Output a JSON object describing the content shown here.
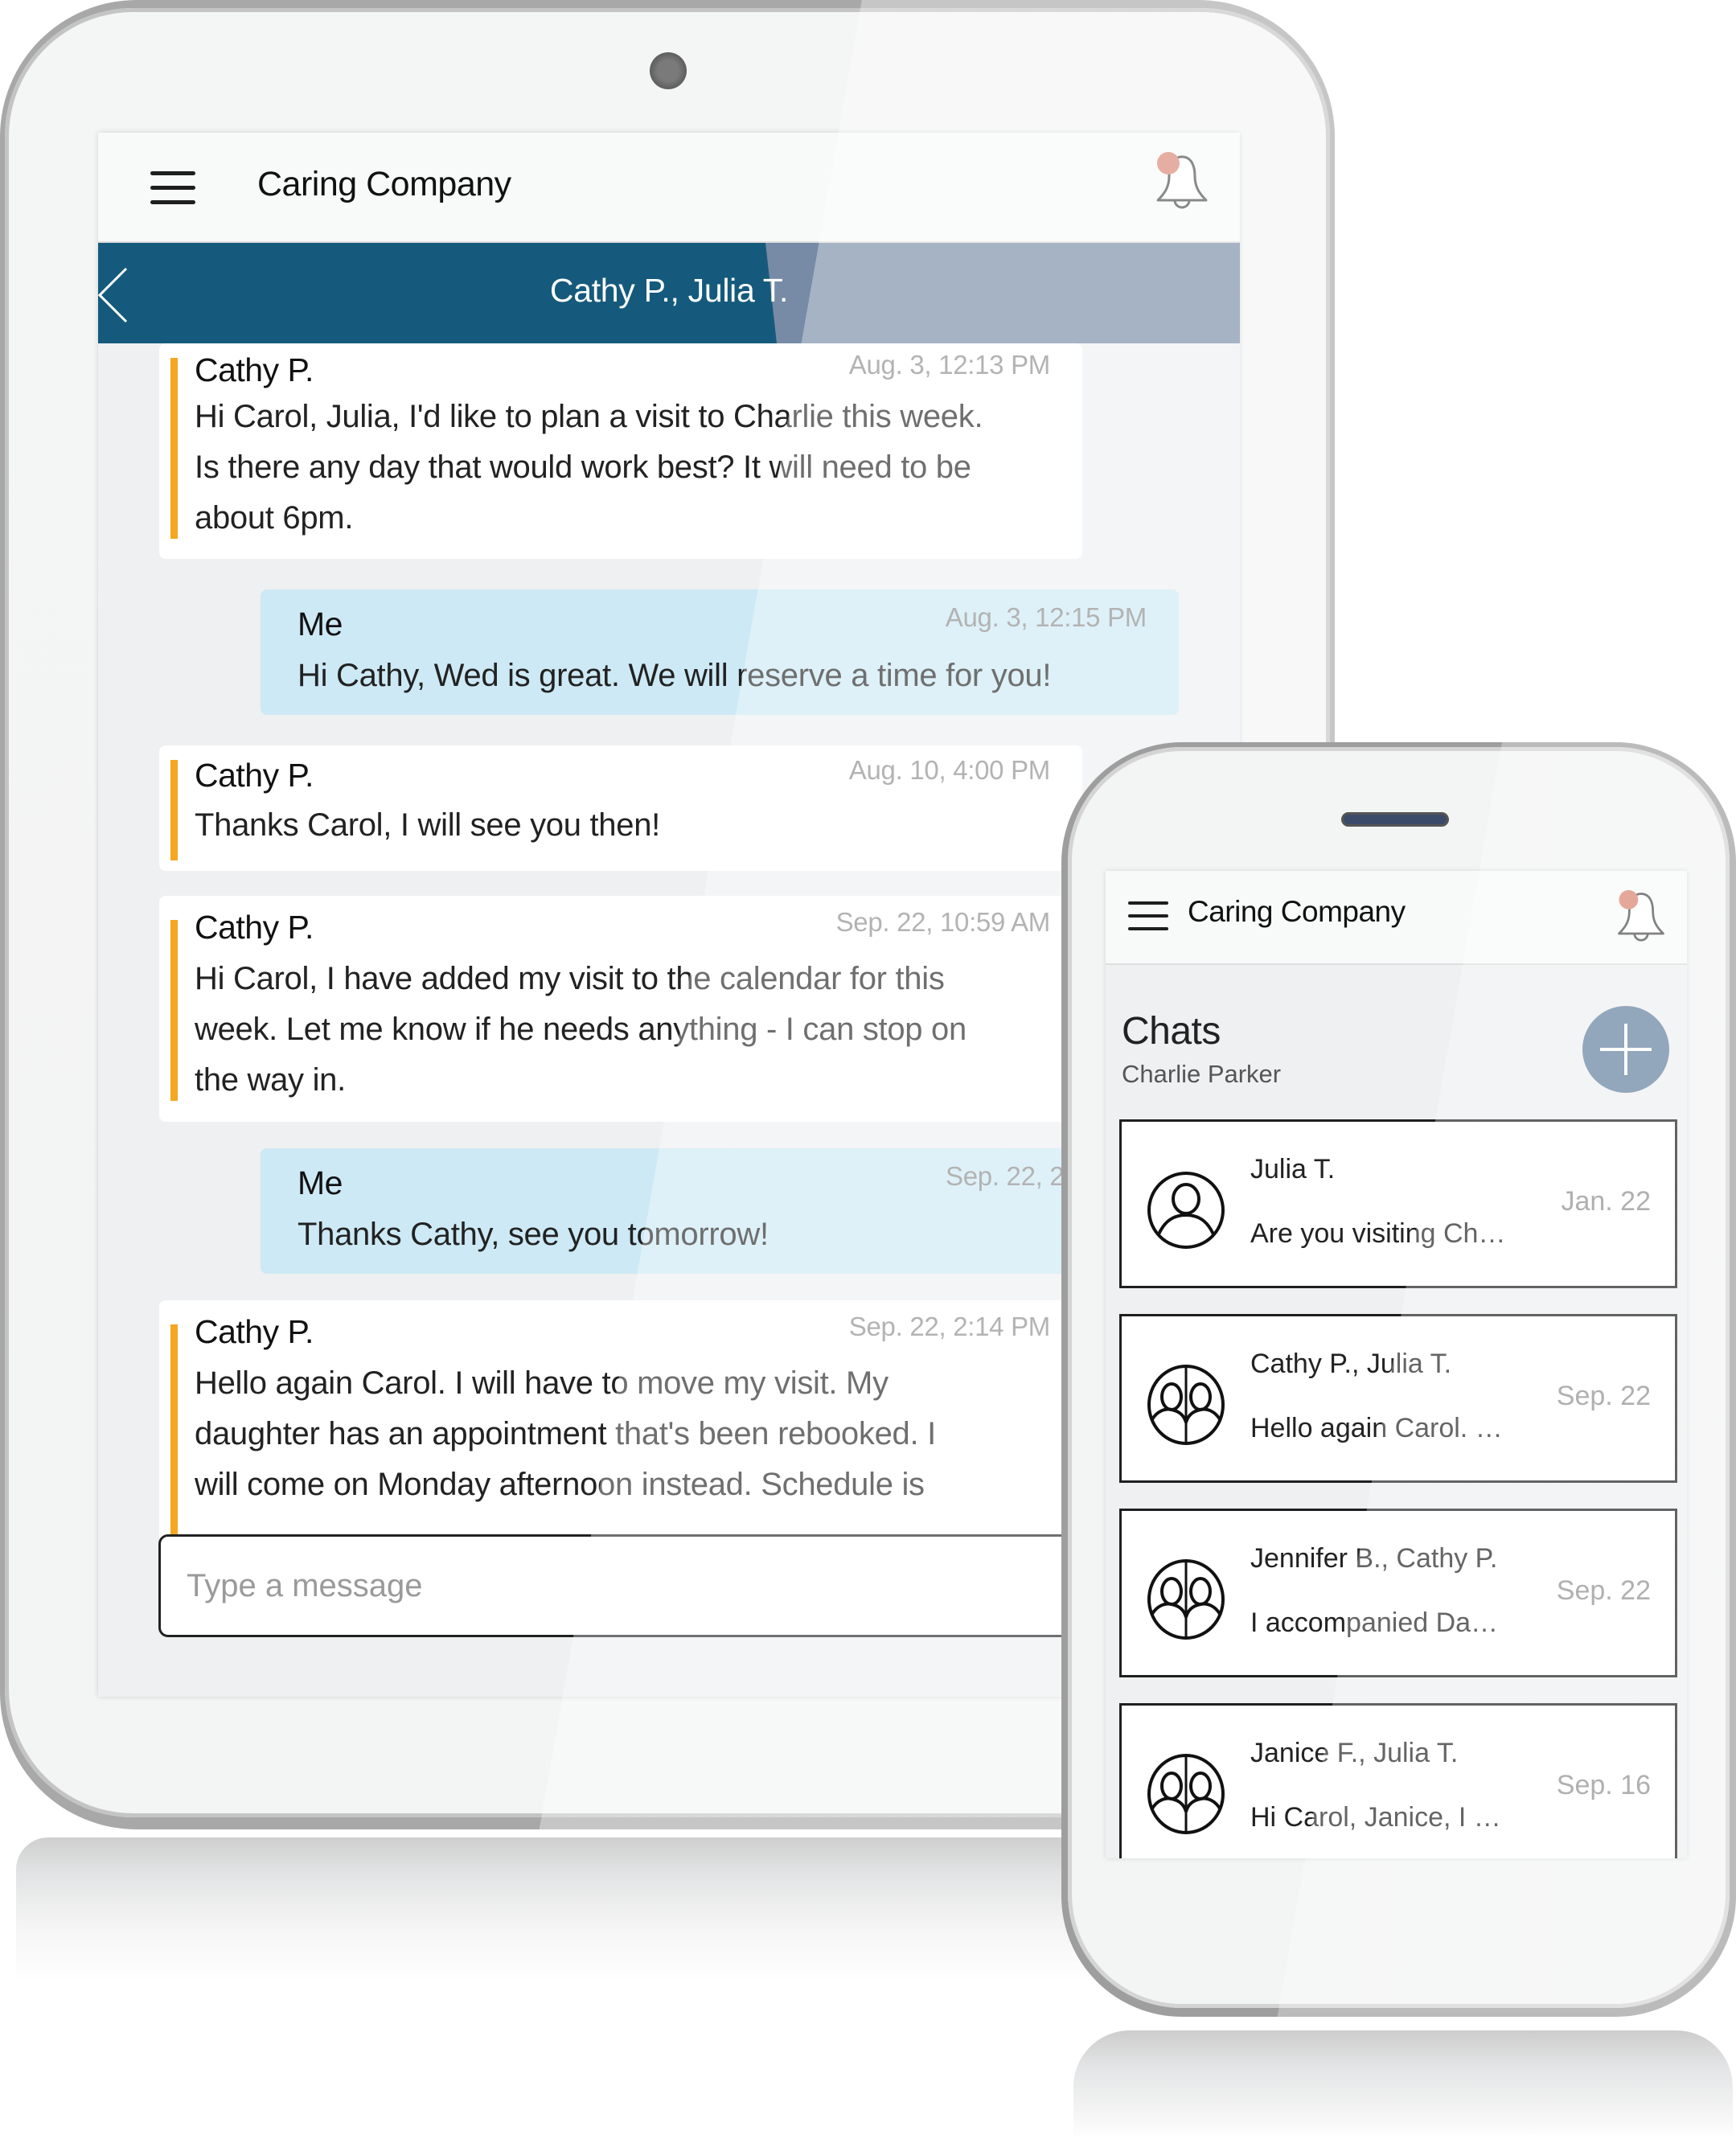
{
  "colors": {
    "brand_teal": "#155a7c",
    "bar_slate": "#778ba6",
    "accent_orange": "#f5a623",
    "my_bubble": "#cde9f5",
    "notification_dot": "#d98270",
    "fab": "#63809f"
  },
  "tablet": {
    "header": {
      "menu_icon": "hamburger-menu-icon",
      "app_title": "Caring Company",
      "bell_icon": "notification-bell-icon",
      "has_notification": true
    },
    "conversation": {
      "back_icon": "chevron-left-icon",
      "title": "Cathy P., Julia T."
    },
    "messages": [
      {
        "sender": "Cathy P.",
        "time": "Aug. 3, 12:13 PM",
        "mine": false,
        "lines": [
          "Hi Carol, Julia, I'd like to plan a visit to Charlie this week.",
          "Is there any day that would work best?   It will need to be",
          "about 6pm."
        ]
      },
      {
        "sender": "Me",
        "time": "Aug. 3, 12:15 PM",
        "mine": true,
        "lines": [
          "Hi Cathy, Wed is great.  We will reserve a time for you!"
        ]
      },
      {
        "sender": "Cathy P.",
        "time": "Aug. 10, 4:00 PM",
        "mine": false,
        "lines": [
          "Thanks Carol, I will see you then!"
        ]
      },
      {
        "sender": "Cathy P.",
        "time": "Sep. 22, 10:59 AM",
        "mine": false,
        "lines": [
          "Hi Carol, I have added my visit to the calendar for this",
          "week.  Let me know if he needs anything - I can stop on",
          "the way in."
        ]
      },
      {
        "sender": "Me",
        "time": "Sep. 22, 2",
        "mine": true,
        "lines": [
          "Thanks Cathy, see you tomorrow!"
        ]
      },
      {
        "sender": "Cathy P.",
        "time": "Sep. 22, 2:14 PM",
        "mine": false,
        "lines": [
          "Hello again Carol.  I will have to move my visit.  My",
          "daughter has an appointment that's been rebooked.   I",
          "will come on Monday afternoon instead.   Schedule is"
        ]
      }
    ],
    "composer": {
      "placeholder": "Type a message",
      "value": ""
    }
  },
  "phone": {
    "header": {
      "menu_icon": "hamburger-menu-icon",
      "app_title": "Caring Company",
      "bell_icon": "notification-bell-icon",
      "has_notification": true
    },
    "section_title": "Chats",
    "section_subtitle": "Charlie Parker",
    "new_chat_icon": "plus-icon",
    "chats": [
      {
        "name": "Julia T.",
        "preview": "Are you visiting Ch…",
        "date": "Jan. 22",
        "avatar": "single-user-icon"
      },
      {
        "name": "Cathy P., Julia T.",
        "preview": "Hello again Carol. …",
        "date": "Sep. 22",
        "avatar": "group-users-icon"
      },
      {
        "name": "Jennifer B., Cathy P.",
        "preview": "I accompanied Da…",
        "date": "Sep. 22",
        "avatar": "group-users-icon"
      },
      {
        "name": "Janice F., Julia T.",
        "preview": "Hi Carol, Janice, I …",
        "date": "Sep. 16",
        "avatar": "group-users-icon"
      }
    ]
  }
}
